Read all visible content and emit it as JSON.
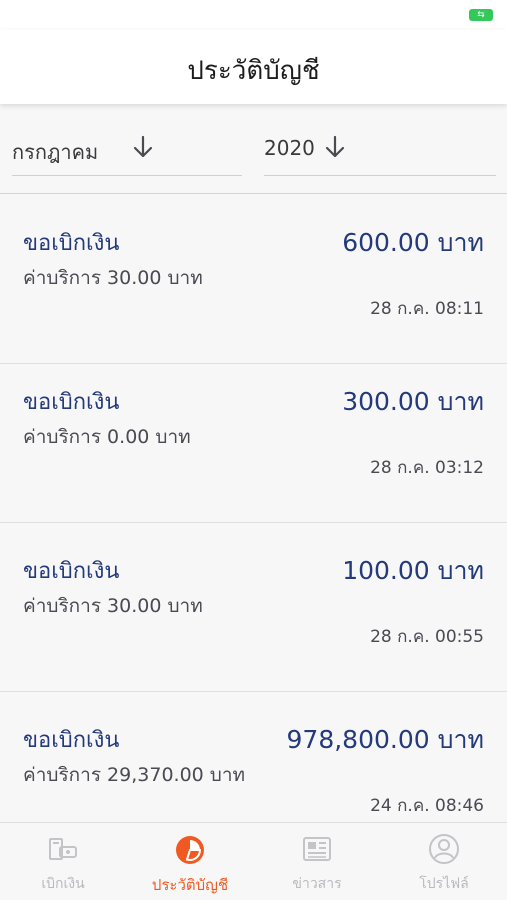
{
  "colors": {
    "accent": "#f05a22",
    "amount_text": "#243a7a",
    "battery": "#34c759",
    "tab_inactive": "#b9b9be"
  },
  "header": {
    "title": "ประวัติบัญชี"
  },
  "filters": {
    "month": {
      "value": "กรกฎาคม",
      "icon": "arrow-down-icon"
    },
    "year": {
      "value": "2020",
      "icon": "arrow-down-icon"
    }
  },
  "transactions": [
    {
      "label": "ขอเบิกเงิน",
      "fee": "ค่าบริการ 30.00 บาท",
      "amount": "600.00 บาท",
      "time": "28 ก.ค. 08:11"
    },
    {
      "label": "ขอเบิกเงิน",
      "fee": "ค่าบริการ 0.00 บาท",
      "amount": "300.00 บาท",
      "time": "28 ก.ค. 03:12"
    },
    {
      "label": "ขอเบิกเงิน",
      "fee": "ค่าบริการ 30.00 บาท",
      "amount": "100.00 บาท",
      "time": "28 ก.ค. 00:55"
    },
    {
      "label": "ขอเบิกเงิน",
      "fee": "ค่าบริการ 29,370.00 บาท",
      "amount": "978,800.00 บาท",
      "time": "24 ก.ค. 08:46"
    }
  ],
  "tabs": [
    {
      "label": "เบิกเงิน",
      "icon": "atm-withdraw-icon",
      "active": false
    },
    {
      "label": "ประวัติบัญชี",
      "icon": "pie-chart-icon",
      "active": true
    },
    {
      "label": "ข่าวสาร",
      "icon": "newspaper-icon",
      "active": false
    },
    {
      "label": "โปรไฟล์",
      "icon": "user-profile-icon",
      "active": false
    }
  ]
}
